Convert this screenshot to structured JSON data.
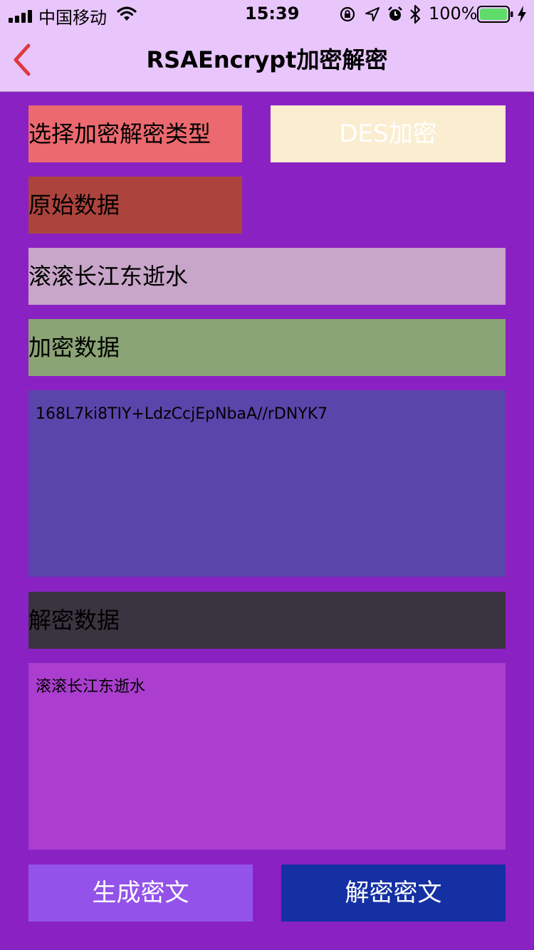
{
  "status_bar": {
    "carrier": "中国移动",
    "time": "15:39",
    "battery_percent": "100%",
    "battery_level": 1.0,
    "icons": [
      "signal-bars-icon",
      "wifi-icon",
      "orientation-lock-icon",
      "location-arrow-icon",
      "alarm-clock-icon",
      "bluetooth-icon",
      "battery-icon",
      "charging-bolt-icon"
    ]
  },
  "nav": {
    "back_icon": "chevron-left-icon",
    "title": "RSAEncrypt加密解密"
  },
  "main": {
    "select_type_label": "选择加密解密类型",
    "type_button": "DES加密",
    "original_label": "原始数据",
    "original_input_value": "滚滚长江东逝水",
    "encrypted_label": "加密数据",
    "encrypted_text": "168L7ki8TIY+LdzCcjEpNbaA//rDNYK7",
    "decrypted_label": "解密数据",
    "decrypted_text": "滚滚长江东逝水",
    "generate_button": "生成密文",
    "decrypt_button": "解密密文"
  },
  "colors": {
    "background": "#8a22c3",
    "nav_background": "#e8c6fc",
    "select_type_label": "#ec6a6f",
    "type_button": "#fbedd0",
    "original_label": "#ad433d",
    "original_input": "#c8a6c9",
    "encrypted_label": "#8ba475",
    "encrypted_text_area": "#5a45ab",
    "decrypted_label": "#3a3340",
    "decrypted_text_area": "#ab3ecf",
    "generate_button": "#9353ea",
    "decrypt_button": "#1530a3",
    "back_icon": "#e0383e"
  }
}
